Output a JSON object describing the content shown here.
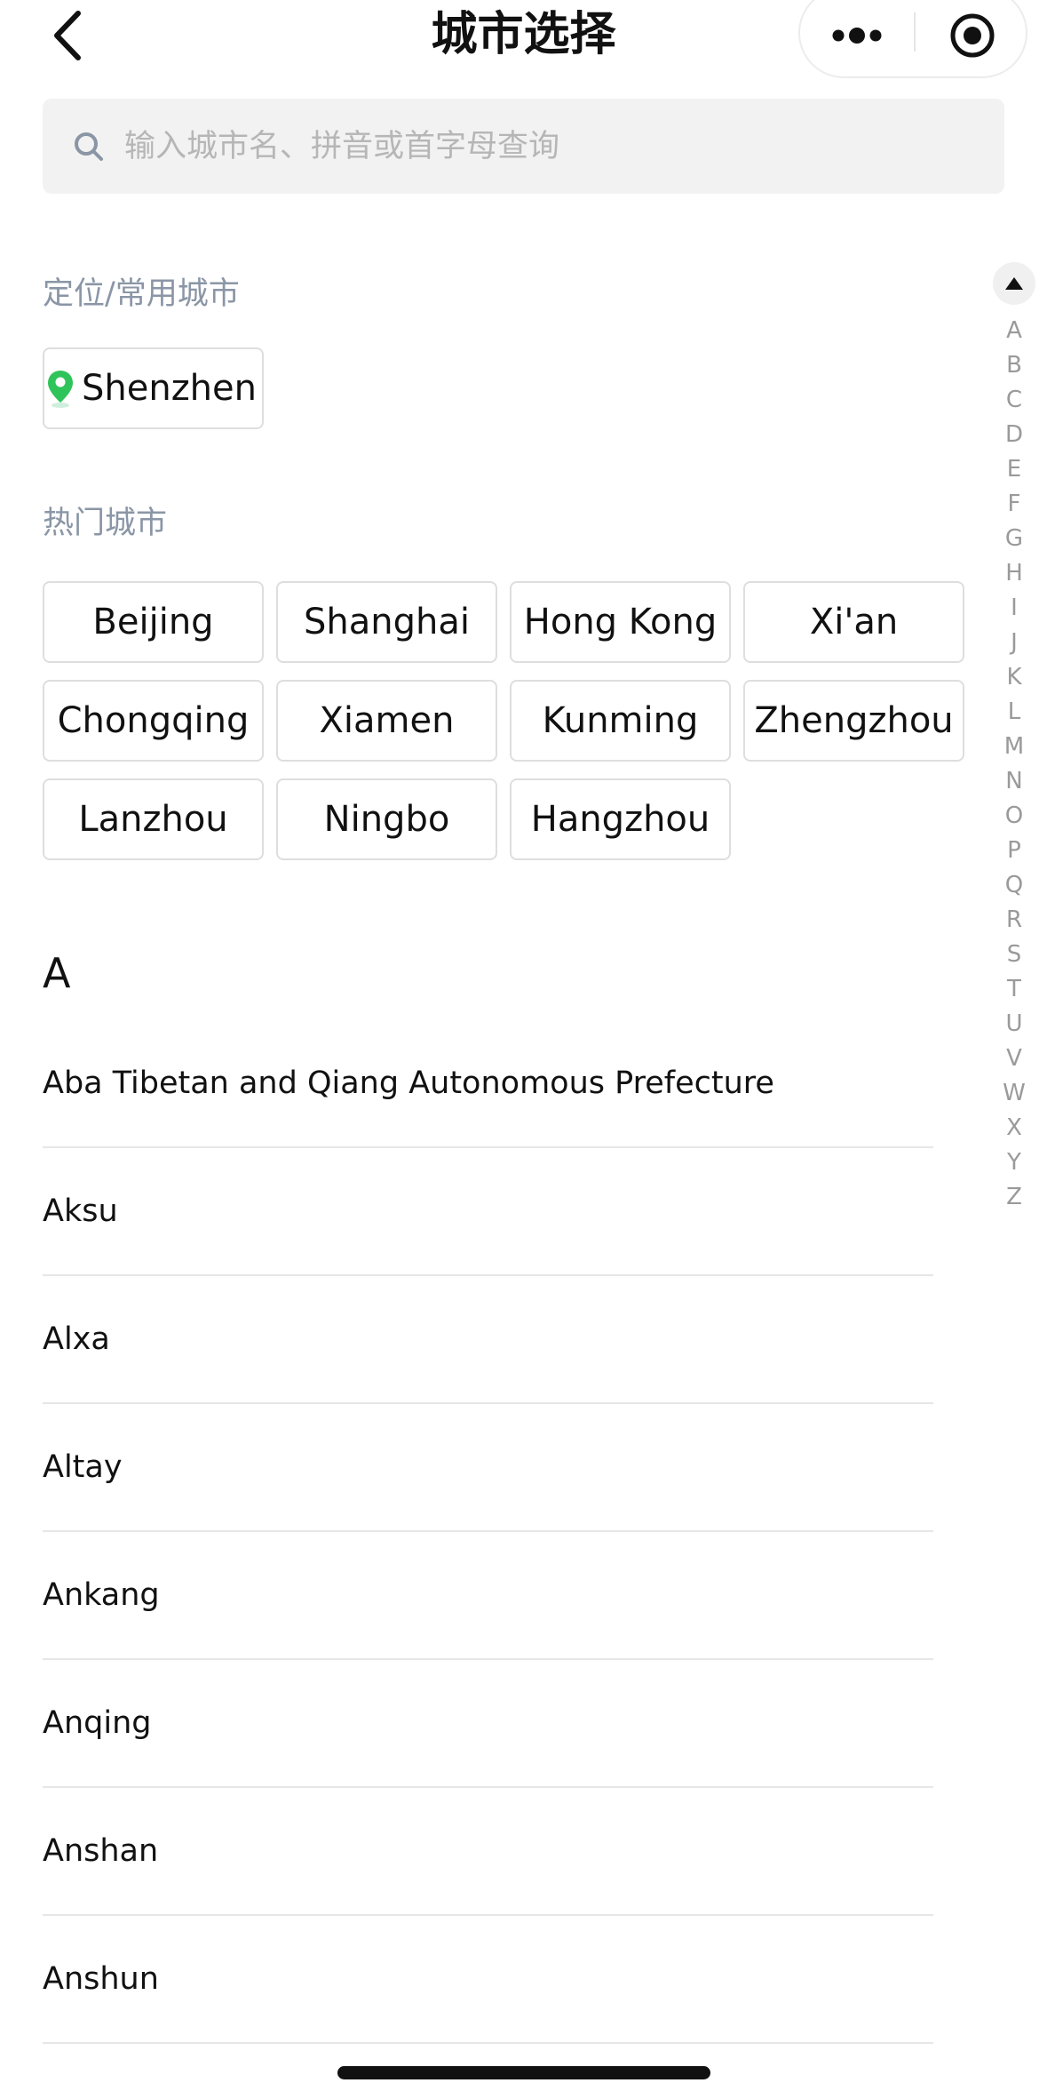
{
  "header": {
    "title": "城市选择",
    "back_icon": "chevron-left-icon",
    "more_icon": "more-dots-icon",
    "close_icon": "target-close-icon"
  },
  "search": {
    "placeholder": "输入城市名、拼音或首字母查询",
    "value": ""
  },
  "location_section": {
    "label": "定位/常用城市",
    "current_city": "Shenzhen",
    "pin_color": "#2fc45a"
  },
  "hot_section": {
    "label": "热门城市",
    "cities": [
      "Beijing",
      "Shanghai",
      "Hong Kong",
      "Xi'an",
      "Chongqing",
      "Xiamen",
      "Kunming",
      "Zhengzhou",
      "Lanzhou",
      "Ningbo",
      "Hangzhou"
    ]
  },
  "letter_section": {
    "letter": "A",
    "cities": [
      "Aba Tibetan and Qiang Autonomous Prefecture",
      "Aksu",
      "Alxa",
      "Altay",
      "Ankang",
      "Anqing",
      "Anshan",
      "Anshun"
    ]
  },
  "index_bar": {
    "letters": [
      "A",
      "B",
      "C",
      "D",
      "E",
      "F",
      "G",
      "H",
      "I",
      "J",
      "K",
      "L",
      "M",
      "N",
      "O",
      "P",
      "Q",
      "R",
      "S",
      "T",
      "U",
      "V",
      "W",
      "X",
      "Y",
      "Z"
    ]
  }
}
